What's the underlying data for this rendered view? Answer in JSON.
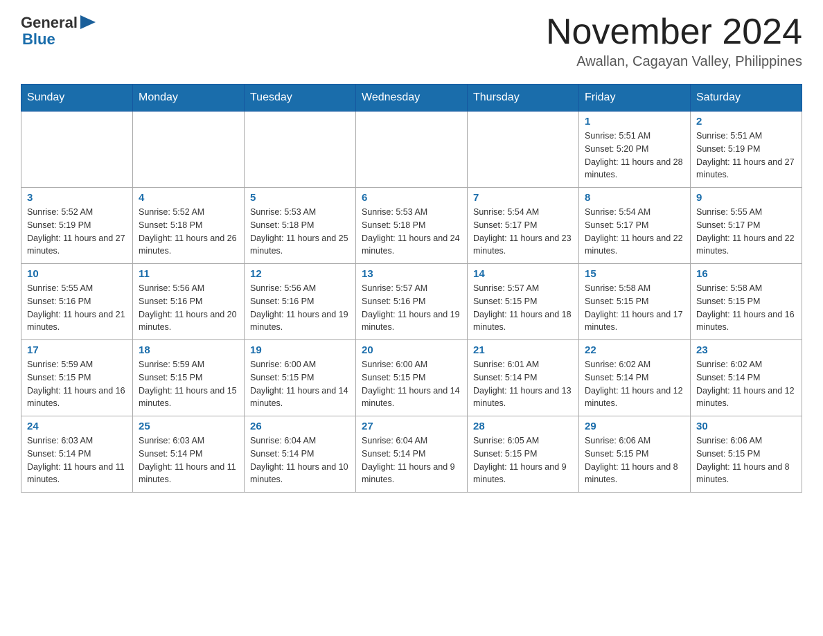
{
  "header": {
    "logo_general": "General",
    "logo_blue": "Blue",
    "month_title": "November 2024",
    "location": "Awallan, Cagayan Valley, Philippines"
  },
  "weekdays": [
    "Sunday",
    "Monday",
    "Tuesday",
    "Wednesday",
    "Thursday",
    "Friday",
    "Saturday"
  ],
  "weeks": [
    {
      "days": [
        {
          "num": "",
          "info": ""
        },
        {
          "num": "",
          "info": ""
        },
        {
          "num": "",
          "info": ""
        },
        {
          "num": "",
          "info": ""
        },
        {
          "num": "",
          "info": ""
        },
        {
          "num": "1",
          "info": "Sunrise: 5:51 AM\nSunset: 5:20 PM\nDaylight: 11 hours and 28 minutes."
        },
        {
          "num": "2",
          "info": "Sunrise: 5:51 AM\nSunset: 5:19 PM\nDaylight: 11 hours and 27 minutes."
        }
      ]
    },
    {
      "days": [
        {
          "num": "3",
          "info": "Sunrise: 5:52 AM\nSunset: 5:19 PM\nDaylight: 11 hours and 27 minutes."
        },
        {
          "num": "4",
          "info": "Sunrise: 5:52 AM\nSunset: 5:18 PM\nDaylight: 11 hours and 26 minutes."
        },
        {
          "num": "5",
          "info": "Sunrise: 5:53 AM\nSunset: 5:18 PM\nDaylight: 11 hours and 25 minutes."
        },
        {
          "num": "6",
          "info": "Sunrise: 5:53 AM\nSunset: 5:18 PM\nDaylight: 11 hours and 24 minutes."
        },
        {
          "num": "7",
          "info": "Sunrise: 5:54 AM\nSunset: 5:17 PM\nDaylight: 11 hours and 23 minutes."
        },
        {
          "num": "8",
          "info": "Sunrise: 5:54 AM\nSunset: 5:17 PM\nDaylight: 11 hours and 22 minutes."
        },
        {
          "num": "9",
          "info": "Sunrise: 5:55 AM\nSunset: 5:17 PM\nDaylight: 11 hours and 22 minutes."
        }
      ]
    },
    {
      "days": [
        {
          "num": "10",
          "info": "Sunrise: 5:55 AM\nSunset: 5:16 PM\nDaylight: 11 hours and 21 minutes."
        },
        {
          "num": "11",
          "info": "Sunrise: 5:56 AM\nSunset: 5:16 PM\nDaylight: 11 hours and 20 minutes."
        },
        {
          "num": "12",
          "info": "Sunrise: 5:56 AM\nSunset: 5:16 PM\nDaylight: 11 hours and 19 minutes."
        },
        {
          "num": "13",
          "info": "Sunrise: 5:57 AM\nSunset: 5:16 PM\nDaylight: 11 hours and 19 minutes."
        },
        {
          "num": "14",
          "info": "Sunrise: 5:57 AM\nSunset: 5:15 PM\nDaylight: 11 hours and 18 minutes."
        },
        {
          "num": "15",
          "info": "Sunrise: 5:58 AM\nSunset: 5:15 PM\nDaylight: 11 hours and 17 minutes."
        },
        {
          "num": "16",
          "info": "Sunrise: 5:58 AM\nSunset: 5:15 PM\nDaylight: 11 hours and 16 minutes."
        }
      ]
    },
    {
      "days": [
        {
          "num": "17",
          "info": "Sunrise: 5:59 AM\nSunset: 5:15 PM\nDaylight: 11 hours and 16 minutes."
        },
        {
          "num": "18",
          "info": "Sunrise: 5:59 AM\nSunset: 5:15 PM\nDaylight: 11 hours and 15 minutes."
        },
        {
          "num": "19",
          "info": "Sunrise: 6:00 AM\nSunset: 5:15 PM\nDaylight: 11 hours and 14 minutes."
        },
        {
          "num": "20",
          "info": "Sunrise: 6:00 AM\nSunset: 5:15 PM\nDaylight: 11 hours and 14 minutes."
        },
        {
          "num": "21",
          "info": "Sunrise: 6:01 AM\nSunset: 5:14 PM\nDaylight: 11 hours and 13 minutes."
        },
        {
          "num": "22",
          "info": "Sunrise: 6:02 AM\nSunset: 5:14 PM\nDaylight: 11 hours and 12 minutes."
        },
        {
          "num": "23",
          "info": "Sunrise: 6:02 AM\nSunset: 5:14 PM\nDaylight: 11 hours and 12 minutes."
        }
      ]
    },
    {
      "days": [
        {
          "num": "24",
          "info": "Sunrise: 6:03 AM\nSunset: 5:14 PM\nDaylight: 11 hours and 11 minutes."
        },
        {
          "num": "25",
          "info": "Sunrise: 6:03 AM\nSunset: 5:14 PM\nDaylight: 11 hours and 11 minutes."
        },
        {
          "num": "26",
          "info": "Sunrise: 6:04 AM\nSunset: 5:14 PM\nDaylight: 11 hours and 10 minutes."
        },
        {
          "num": "27",
          "info": "Sunrise: 6:04 AM\nSunset: 5:14 PM\nDaylight: 11 hours and 9 minutes."
        },
        {
          "num": "28",
          "info": "Sunrise: 6:05 AM\nSunset: 5:15 PM\nDaylight: 11 hours and 9 minutes."
        },
        {
          "num": "29",
          "info": "Sunrise: 6:06 AM\nSunset: 5:15 PM\nDaylight: 11 hours and 8 minutes."
        },
        {
          "num": "30",
          "info": "Sunrise: 6:06 AM\nSunset: 5:15 PM\nDaylight: 11 hours and 8 minutes."
        }
      ]
    }
  ]
}
